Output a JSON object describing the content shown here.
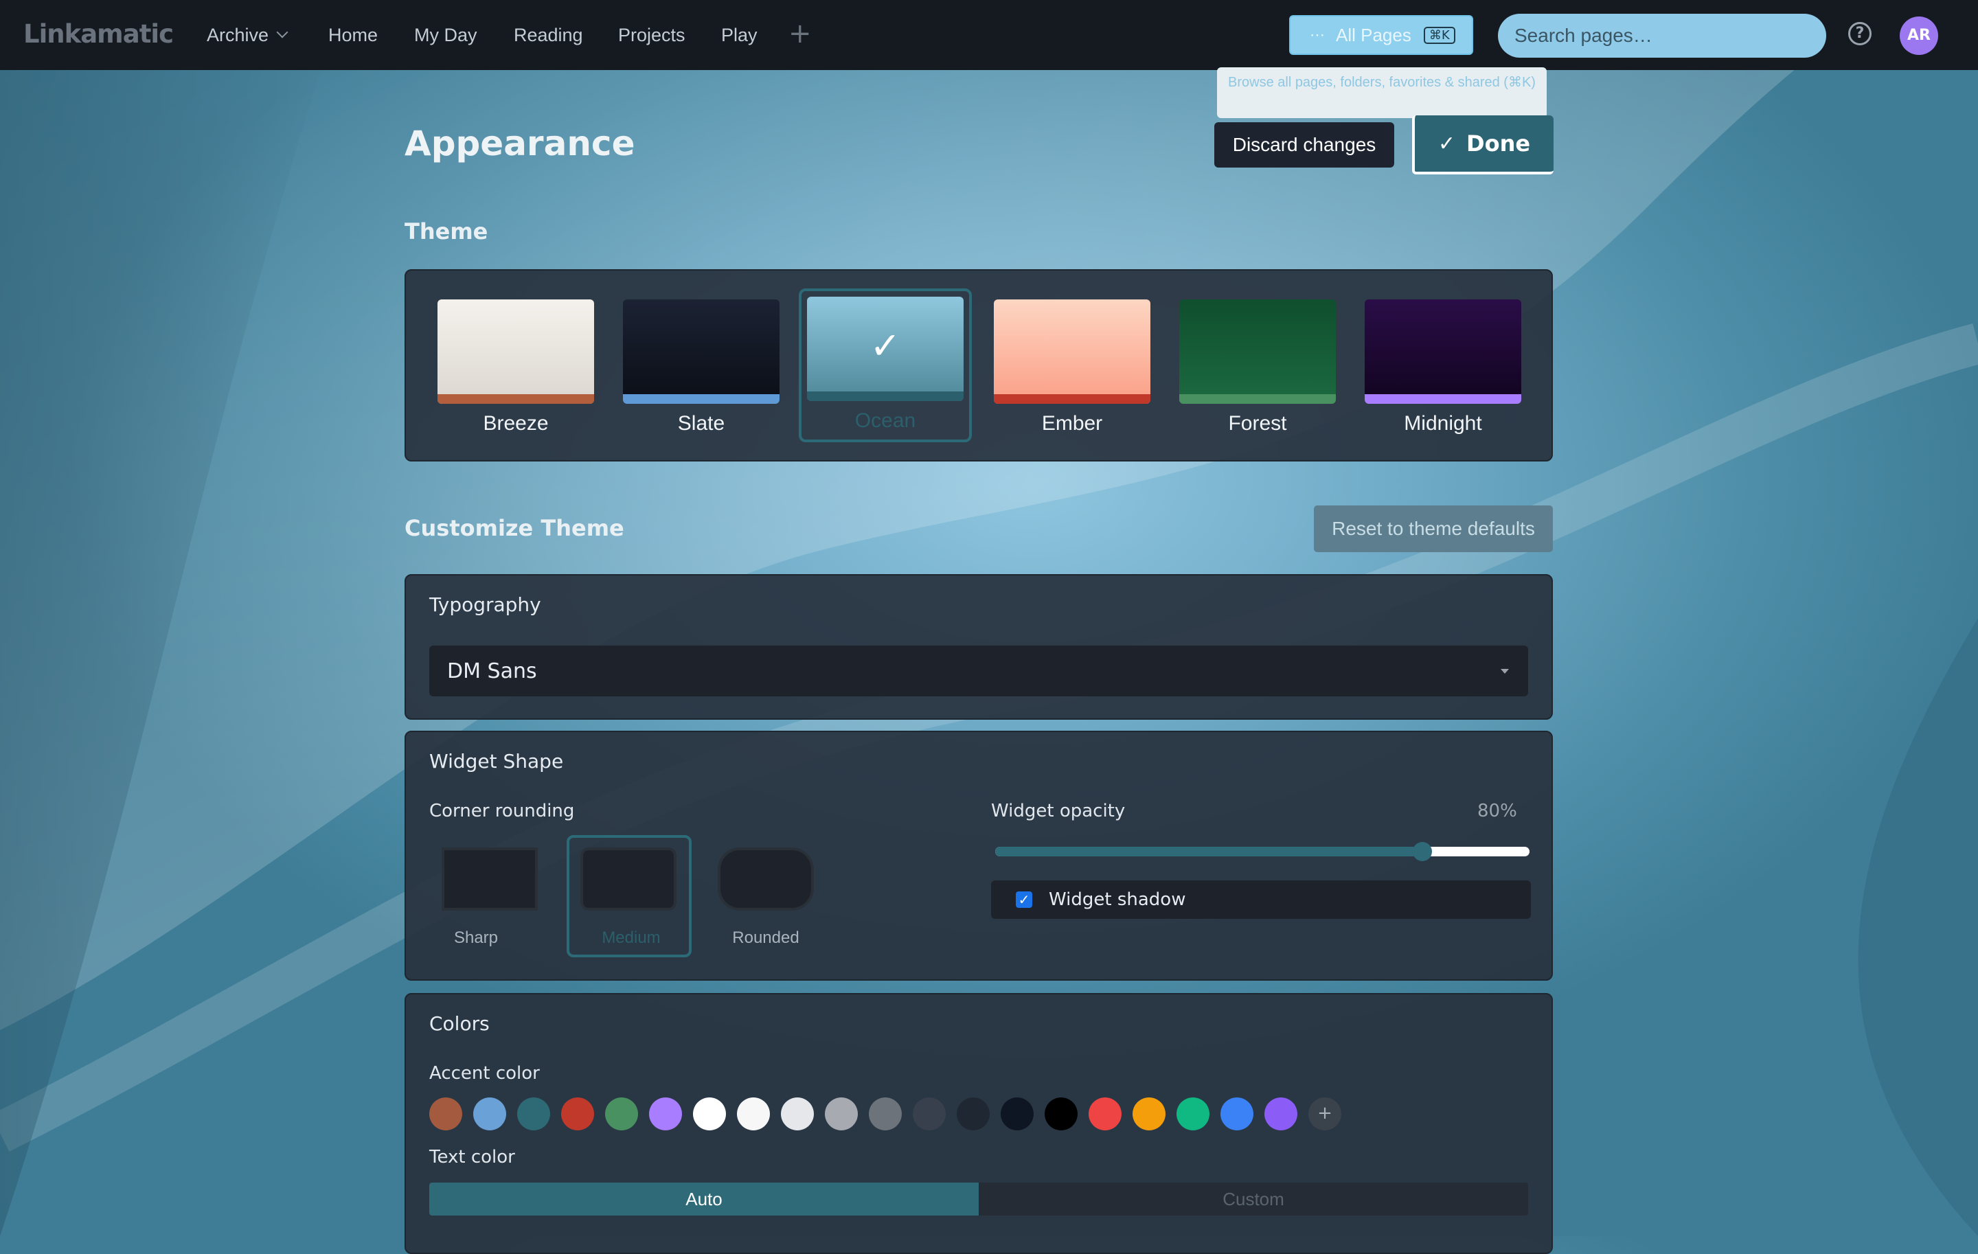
{
  "app": {
    "logo": "Linkamatic"
  },
  "nav": {
    "archive": "Archive",
    "items": [
      "Home",
      "My Day",
      "Reading",
      "Projects",
      "Play"
    ],
    "add": "+"
  },
  "allpages": {
    "dots": "⋯",
    "label": "All Pages",
    "shortcut": "⌘K"
  },
  "search": {
    "placeholder": "Search pages…"
  },
  "help": {
    "glyph": "?"
  },
  "user": {
    "initials": "AR"
  },
  "tooltip": {
    "text": "Browse all pages, folders, favorites & shared (⌘K)"
  },
  "page": {
    "title": "Appearance",
    "discard": "Discard changes",
    "done": "Done",
    "done_check": "✓"
  },
  "theme": {
    "section": "Theme",
    "selected": "Ocean",
    "items": [
      {
        "name": "Breeze",
        "top": "#f4f1ec",
        "bottom": "#dcd7d0",
        "bar": "#b35f3d"
      },
      {
        "name": "Slate",
        "top": "#1b2233",
        "bottom": "#0b0e16",
        "bar": "#5f9ad6"
      },
      {
        "name": "Ocean",
        "top": "#8fc7de",
        "bottom": "#4d8797",
        "bar": "#2c5f6c"
      },
      {
        "name": "Ember",
        "top": "#fcd6c2",
        "bottom": "#fb9e86",
        "bar": "#c0392b"
      },
      {
        "name": "Forest",
        "top": "#0f4f2e",
        "bottom": "#1c6a40",
        "bar": "#4a9161"
      },
      {
        "name": "Midnight",
        "top": "#2a0d47",
        "bottom": "#11041f",
        "bar": "#a87dff"
      }
    ],
    "check": "✓"
  },
  "customize": {
    "section": "Customize Theme",
    "reset": "Reset to theme defaults"
  },
  "typography": {
    "title": "Typography",
    "font": "DM Sans"
  },
  "widget": {
    "title": "Widget Shape",
    "corner_label": "Corner rounding",
    "shapes": [
      "Sharp",
      "Medium",
      "Rounded"
    ],
    "selected_shape": "Medium",
    "opacity_label": "Widget opacity",
    "opacity_value": "80%",
    "opacity_fraction": 0.8,
    "shadow_label": "Widget shadow",
    "shadow_checked": true
  },
  "colors": {
    "title": "Colors",
    "accent_label": "Accent color",
    "accent_swatches": [
      "#a45a3e",
      "#6aa1d6",
      "#2e6a76",
      "#c0392b",
      "#4a9161",
      "#a87dff",
      "#ffffff",
      "#f7f7f7",
      "#e5e7ea",
      "#a7abb1",
      "#6d737b",
      "#37404c",
      "#1f2733",
      "#0f1623",
      "#000000",
      "#ef4444",
      "#f59e0b",
      "#10b981",
      "#3b82f6",
      "#8b5cf6"
    ],
    "add_label": "+",
    "text_label": "Text color",
    "text_options": [
      "Auto",
      "Custom"
    ]
  }
}
